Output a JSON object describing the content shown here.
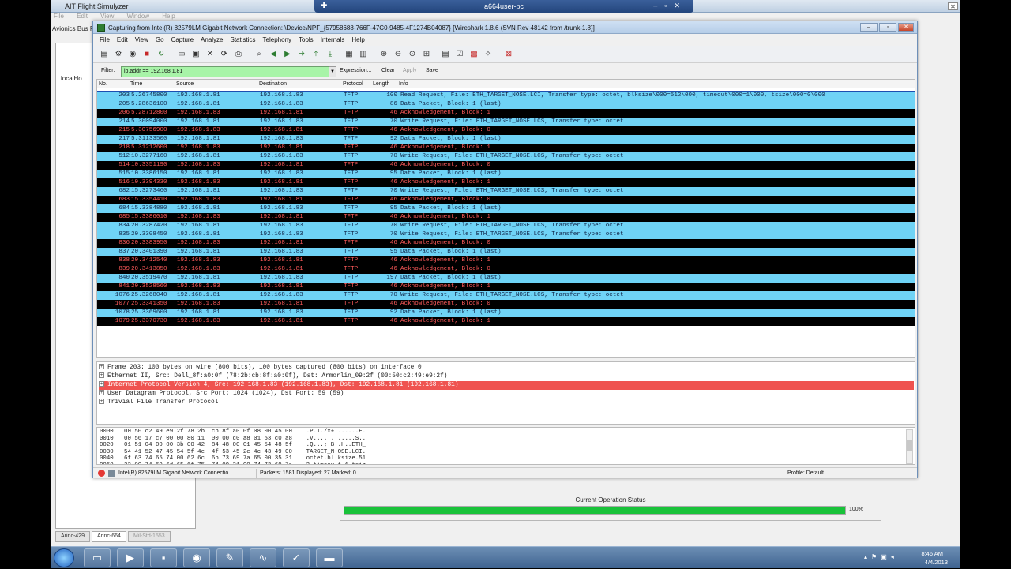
{
  "background_app": {
    "title": "AIT Flight Simulyzer",
    "menu": [
      "File",
      "Edit",
      "View",
      "Window",
      "Help"
    ],
    "side_label": "Avionics Bus Re",
    "tree_root": "localHo",
    "tabs": [
      "Arinc-429",
      "Arinc-664",
      "Mil-Std-1553"
    ],
    "status_label": "Current Operation Status",
    "progress_text": "100%",
    "progress_value": 1.0
  },
  "remote_bar": {
    "title": "a664user-pc"
  },
  "wireshark": {
    "title": "Capturing from Intel(R) 82579LM Gigabit Network Connection: \\Device\\NPF_{57958688-766F-47C0-9485-4F1274B04087}   [Wireshark 1.8.6 (SVN Rev 48142 from /trunk-1.8)]",
    "menu": [
      "File",
      "Edit",
      "View",
      "Go",
      "Capture",
      "Analyze",
      "Statistics",
      "Telephony",
      "Tools",
      "Internals",
      "Help"
    ],
    "filter": {
      "label": "Filter:",
      "value": "ip.addr == 192.168.1.81",
      "buttons": [
        "Expression...",
        "Clear",
        "Apply",
        "Save"
      ]
    },
    "columns": [
      "No.",
      "Time",
      "Source",
      "Destination",
      "Protocol",
      "Length",
      "Info"
    ],
    "packets": [
      {
        "no": "203",
        "time": "5.26745800",
        "src": "192.168.1.81",
        "dst": "192.168.1.83",
        "proto": "TFTP",
        "len": "100",
        "info": "Read Request, File: ETH_TARGET_NOSE.LCI, Transfer type: octet, blksize\\000=512\\000, timeout\\000=1\\000, tsize\\000=0\\000",
        "style": "blue"
      },
      {
        "no": "205",
        "time": "5.28636100",
        "src": "192.168.1.81",
        "dst": "192.168.1.83",
        "proto": "TFTP",
        "len": "86",
        "info": "Data Packet, Block: 1 (last)",
        "style": "blue"
      },
      {
        "no": "206",
        "time": "5.28712800",
        "src": "192.168.1.83",
        "dst": "192.168.1.81",
        "proto": "TFTP",
        "len": "46",
        "info": "Acknowledgement, Block: 1",
        "style": "black"
      },
      {
        "no": "214",
        "time": "5.30094000",
        "src": "192.168.1.81",
        "dst": "192.168.1.83",
        "proto": "TFTP",
        "len": "70",
        "info": "Write Request, File: ETH_TARGET_NOSE.LCS, Transfer type: octet",
        "style": "blue"
      },
      {
        "no": "215",
        "time": "5.30756900",
        "src": "192.168.1.83",
        "dst": "192.168.1.81",
        "proto": "TFTP",
        "len": "46",
        "info": "Acknowledgement, Block: 0",
        "style": "black"
      },
      {
        "no": "217",
        "time": "5.31133500",
        "src": "192.168.1.81",
        "dst": "192.168.1.83",
        "proto": "TFTP",
        "len": "92",
        "info": "Data Packet, Block: 1 (last)",
        "style": "blue"
      },
      {
        "no": "218",
        "time": "5.31212600",
        "src": "192.168.1.83",
        "dst": "192.168.1.81",
        "proto": "TFTP",
        "len": "46",
        "info": "Acknowledgement, Block: 1",
        "style": "black"
      },
      {
        "no": "512",
        "time": "10.3277160",
        "src": "192.168.1.81",
        "dst": "192.168.1.83",
        "proto": "TFTP",
        "len": "70",
        "info": "Write Request, File: ETH_TARGET_NOSE.LCS, Transfer type: octet",
        "style": "blue"
      },
      {
        "no": "514",
        "time": "10.3351190",
        "src": "192.168.1.83",
        "dst": "192.168.1.81",
        "proto": "TFTP",
        "len": "46",
        "info": "Acknowledgement, Block: 0",
        "style": "black"
      },
      {
        "no": "515",
        "time": "10.3386150",
        "src": "192.168.1.81",
        "dst": "192.168.1.83",
        "proto": "TFTP",
        "len": "95",
        "info": "Data Packet, Block: 1 (last)",
        "style": "blue"
      },
      {
        "no": "516",
        "time": "10.3394330",
        "src": "192.168.1.83",
        "dst": "192.168.1.81",
        "proto": "TFTP",
        "len": "46",
        "info": "Acknowledgement, Block: 1",
        "style": "black"
      },
      {
        "no": "682",
        "time": "15.3273460",
        "src": "192.168.1.81",
        "dst": "192.168.1.83",
        "proto": "TFTP",
        "len": "70",
        "info": "Write Request, File: ETH_TARGET_NOSE.LCS, Transfer type: octet",
        "style": "blue"
      },
      {
        "no": "683",
        "time": "15.3354410",
        "src": "192.168.1.83",
        "dst": "192.168.1.81",
        "proto": "TFTP",
        "len": "46",
        "info": "Acknowledgement, Block: 0",
        "style": "black"
      },
      {
        "no": "684",
        "time": "15.3384880",
        "src": "192.168.1.81",
        "dst": "192.168.1.83",
        "proto": "TFTP",
        "len": "95",
        "info": "Data Packet, Block: 1 (last)",
        "style": "blue"
      },
      {
        "no": "685",
        "time": "15.3386010",
        "src": "192.168.1.83",
        "dst": "192.168.1.81",
        "proto": "TFTP",
        "len": "46",
        "info": "Acknowledgement, Block: 1",
        "style": "black"
      },
      {
        "no": "834",
        "time": "20.3287420",
        "src": "192.168.1.81",
        "dst": "192.168.1.83",
        "proto": "TFTP",
        "len": "70",
        "info": "Write Request, File: ETH_TARGET_NOSE.LCS, Transfer type: octet",
        "style": "blue"
      },
      {
        "no": "835",
        "time": "20.3308450",
        "src": "192.168.1.81",
        "dst": "192.168.1.83",
        "proto": "TFTP",
        "len": "70",
        "info": "Write Request, File: ETH_TARGET_NOSE.LCS, Transfer type: octet",
        "style": "blue"
      },
      {
        "no": "836",
        "time": "20.3383950",
        "src": "192.168.1.83",
        "dst": "192.168.1.81",
        "proto": "TFTP",
        "len": "46",
        "info": "Acknowledgement, Block: 0",
        "style": "black"
      },
      {
        "no": "837",
        "time": "20.3401390",
        "src": "192.168.1.81",
        "dst": "192.168.1.83",
        "proto": "TFTP",
        "len": "95",
        "info": "Data Packet, Block: 1 (last)",
        "style": "blue"
      },
      {
        "no": "838",
        "time": "20.3412540",
        "src": "192.168.1.83",
        "dst": "192.168.1.81",
        "proto": "TFTP",
        "len": "46",
        "info": "Acknowledgement, Block: 1",
        "style": "black"
      },
      {
        "no": "839",
        "time": "20.3413850",
        "src": "192.168.1.83",
        "dst": "192.168.1.81",
        "proto": "TFTP",
        "len": "46",
        "info": "Acknowledgement, Block: 0",
        "style": "black"
      },
      {
        "no": "840",
        "time": "20.3519470",
        "src": "192.168.1.81",
        "dst": "192.168.1.83",
        "proto": "TFTP",
        "len": "197",
        "info": "Data Packet, Block: 1 (last)",
        "style": "blue"
      },
      {
        "no": "841",
        "time": "20.3528560",
        "src": "192.168.1.83",
        "dst": "192.168.1.81",
        "proto": "TFTP",
        "len": "46",
        "info": "Acknowledgement, Block: 1",
        "style": "black"
      },
      {
        "no": "1076",
        "time": "25.3268040",
        "src": "192.168.1.81",
        "dst": "192.168.1.83",
        "proto": "TFTP",
        "len": "70",
        "info": "Write Request, File: ETH_TARGET_NOSE.LCS, Transfer type: octet",
        "style": "blue"
      },
      {
        "no": "1077",
        "time": "25.3341350",
        "src": "192.168.1.83",
        "dst": "192.168.1.81",
        "proto": "TFTP",
        "len": "46",
        "info": "Acknowledgement, Block: 0",
        "style": "black"
      },
      {
        "no": "1078",
        "time": "25.3369600",
        "src": "192.168.1.81",
        "dst": "192.168.1.83",
        "proto": "TFTP",
        "len": "92",
        "info": "Data Packet, Block: 1 (last)",
        "style": "blue"
      },
      {
        "no": "1079",
        "time": "25.3370730",
        "src": "192.168.1.83",
        "dst": "192.168.1.81",
        "proto": "TFTP",
        "len": "46",
        "info": "Acknowledgement, Block: 1",
        "style": "black"
      }
    ],
    "details": [
      {
        "text": "Frame 203: 100 bytes on wire (800 bits), 100 bytes captured (800 bits) on interface 0",
        "hl": false
      },
      {
        "text": "Ethernet II, Src: Dell_8f:a0:0f (78:2b:cb:8f:a0:0f), Dst: Armorlin_09:2f (00:50:c2:49:e9:2f)",
        "hl": false
      },
      {
        "text": "Internet Protocol Version 4, Src: 192.168.1.83 (192.168.1.83), Dst: 192.168.1.81 (192.168.1.81)",
        "hl": true
      },
      {
        "text": "User Datagram Protocol, Src Port: 1024 (1024), Dst Port: 59 (59)",
        "hl": false
      },
      {
        "text": "Trivial File Transfer Protocol",
        "hl": false
      }
    ],
    "hex": [
      "0000   00 50 c2 49 e9 2f 78 2b  cb 8f a0 0f 08 00 45 00    .P.I./x+ ......E.",
      "0010   00 56 17 c7 00 00 80 11  00 00 c0 a8 01 53 c0 a8    .V...... .....S..",
      "0020   01 51 04 00 00 3b 00 42  84 48 00 01 45 54 48 5f    .Q...;.B .H..ETH_",
      "0030   54 41 52 47 45 54 5f 4e  4f 53 45 2e 4c 43 49 00    TARGET_N OSE.LCI.",
      "0040   6f 63 74 65 74 00 62 6c  6b 73 69 7a 65 00 35 31    octet.bl ksize.51",
      "0050   32 00 74 69 6d 65 6f 75  74 00 31 00 74 73 69 7a    2.timeou t.1.tsiz"
    ],
    "status": {
      "interface": "Intel(R) 82579LM Gigabit Network Connectio...",
      "packets": "Packets: 1581 Displayed: 27 Marked: 0",
      "profile": "Profile: Default"
    }
  },
  "taskbar": {
    "time": "8:46 AM",
    "date": "4/4/2013"
  },
  "colors": {
    "row_blue": "#6fd3f6",
    "row_black": "#000000",
    "row_black_text": "#ff5b5b",
    "filter_valid": "#a8f4a8",
    "detail_highlight": "#ef5350",
    "progress_fill": "#19c23a"
  }
}
